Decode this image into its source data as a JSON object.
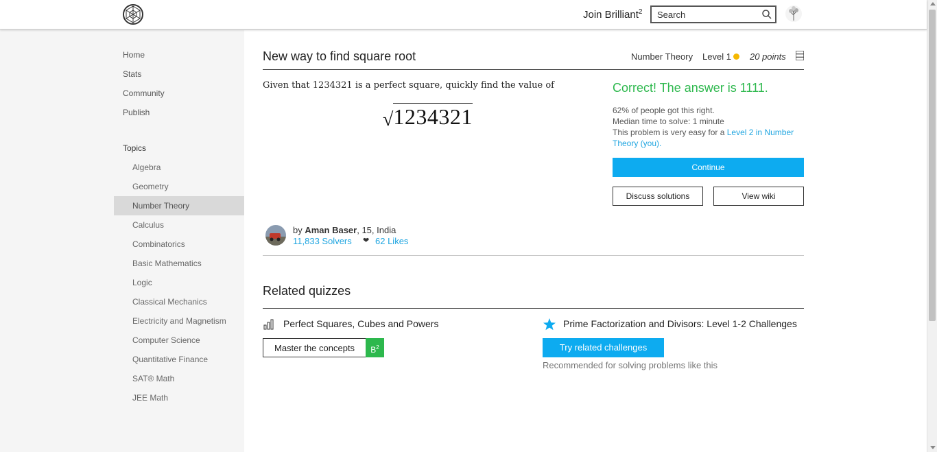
{
  "header": {
    "join_label": "Join Brilliant",
    "join_sup": "2",
    "search_placeholder": "Search"
  },
  "sidebar": {
    "links": [
      "Home",
      "Stats",
      "Community",
      "Publish"
    ],
    "topics_heading": "Topics",
    "topics": [
      "Algebra",
      "Geometry",
      "Number Theory",
      "Calculus",
      "Combinatorics",
      "Basic Mathematics",
      "Logic",
      "Classical Mechanics",
      "Electricity and Magnetism",
      "Computer Science",
      "Quantitative Finance",
      "SAT® Math",
      "JEE Math"
    ],
    "active_topic": "Number Theory"
  },
  "problem": {
    "title": "New way to find square root",
    "topic": "Number Theory",
    "level": "Level 1",
    "points": "20 points",
    "question": "Given that 1234321 is a perfect square, quickly find the value of",
    "radicand": "1234321"
  },
  "result": {
    "correct_text": "Correct! The answer is 1111.",
    "percent_text": "62% of people got this right.",
    "median_text": "Median time to solve: 1 minute",
    "easy_prefix": "This problem is very easy for a ",
    "easy_link": "Level 2 in Number Theory (you).",
    "continue_label": "Continue",
    "discuss_label": "Discuss solutions",
    "wiki_label": "View wiki"
  },
  "author": {
    "by": "by ",
    "name": "Aman Baser",
    "details": ", 15, India",
    "solvers": "11,833 Solvers",
    "likes": "62 Likes"
  },
  "related": {
    "heading": "Related quizzes",
    "quiz_title": "Perfect Squares, Cubes and Powers",
    "master_label": "Master the concepts",
    "badge": "B",
    "badge_sup": "2",
    "challenge_title": "Prime Factorization and Divisors: Level 1-2 Challenges",
    "try_label": "Try related challenges",
    "recommendation": "Recommended for solving problems like this"
  },
  "colors": {
    "accent_blue": "#0dabf0",
    "success_green": "#2db84d",
    "level_yellow": "#f5b800"
  },
  "icons": [
    "brilliant-logo-icon",
    "search-icon",
    "user-avatar-icon",
    "menu-icon",
    "bar-chart-icon",
    "star-icon",
    "heart-icon"
  ]
}
